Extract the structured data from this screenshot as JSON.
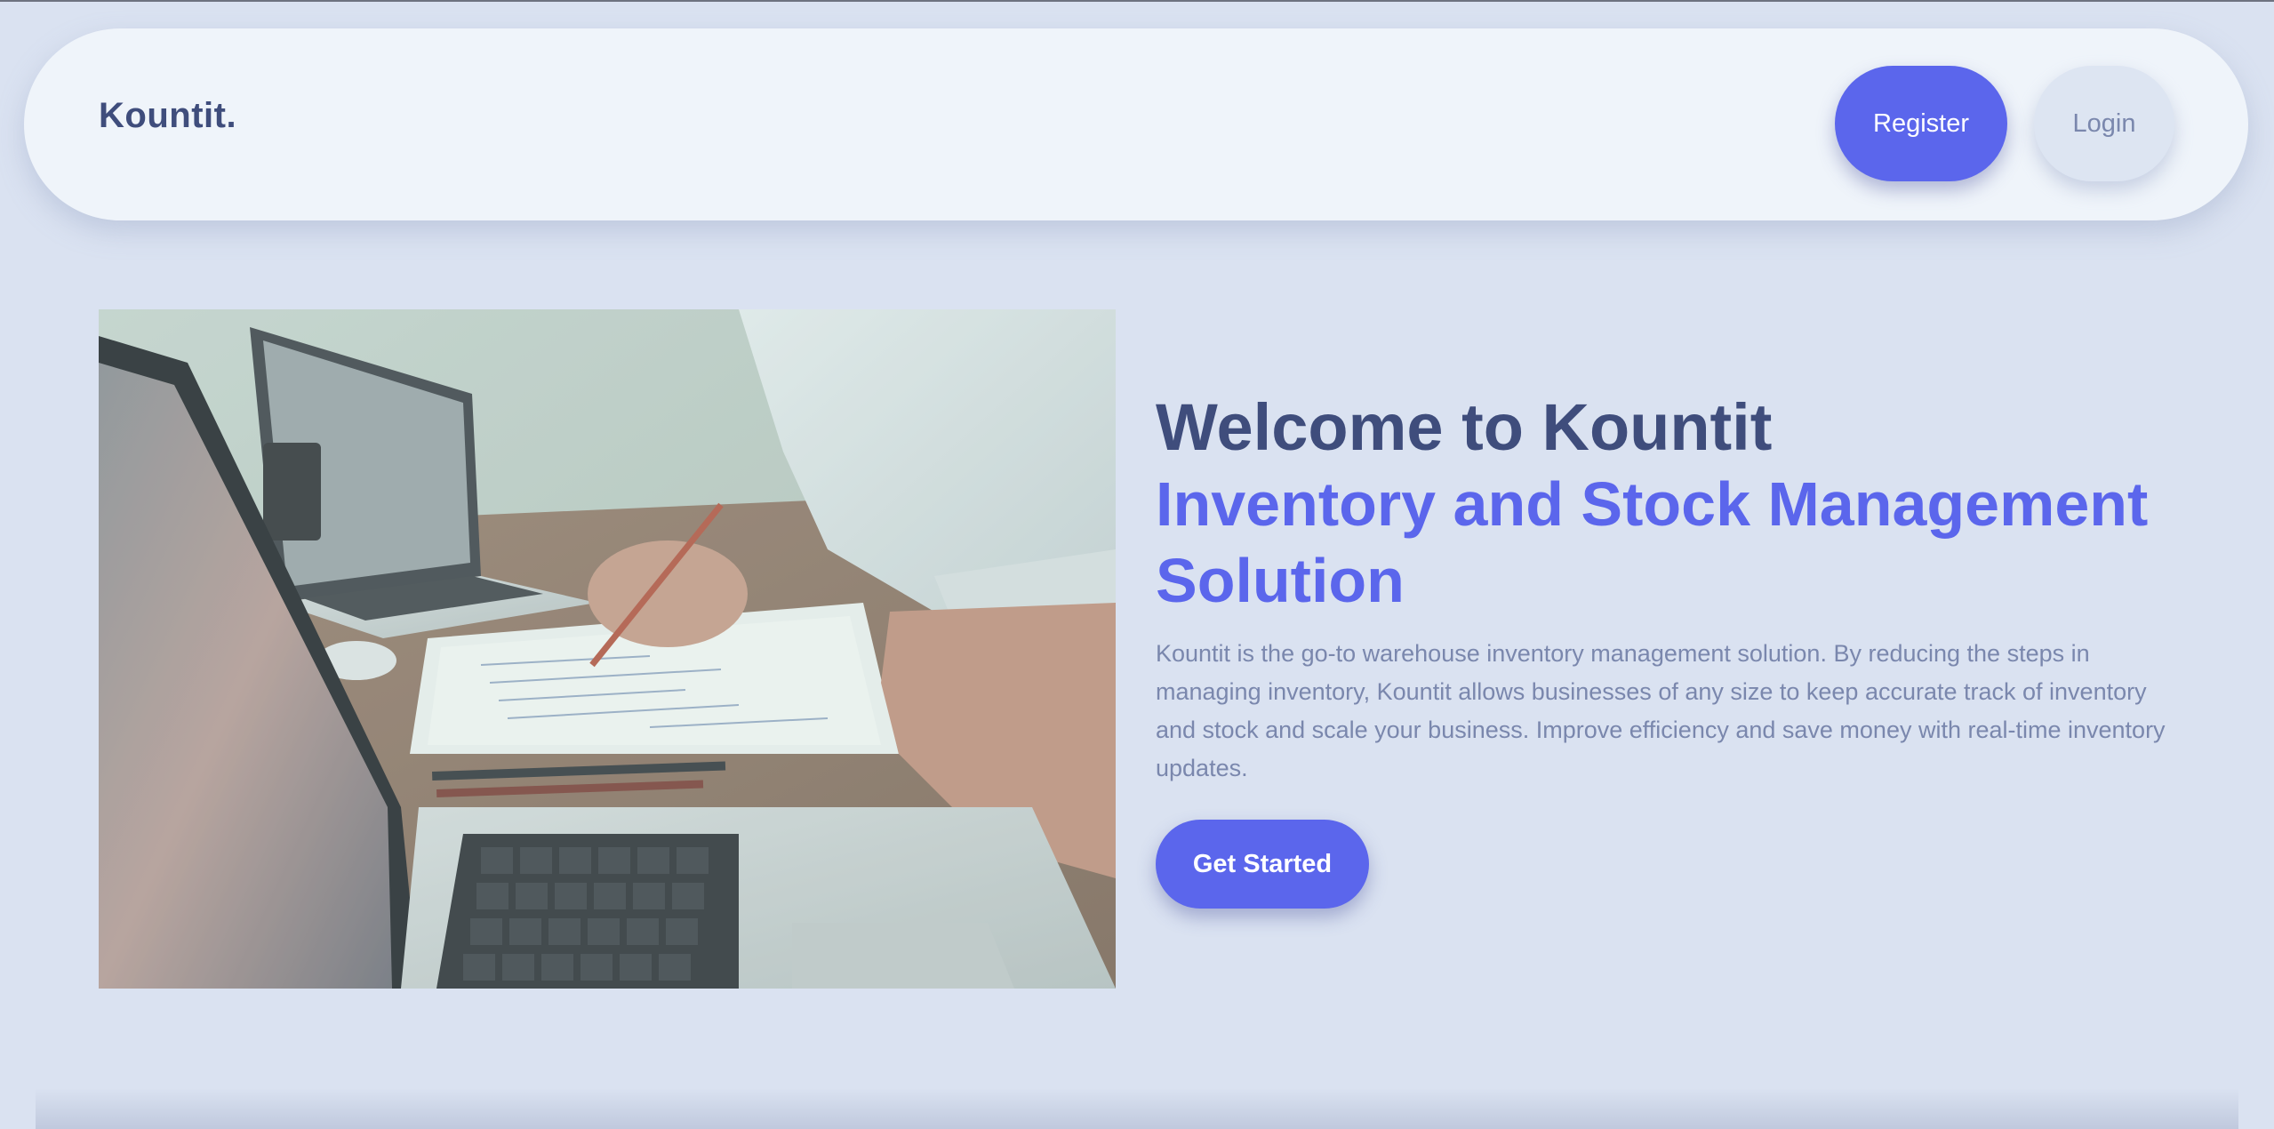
{
  "header": {
    "brand": "Kountit.",
    "register_label": "Register",
    "login_label": "Login"
  },
  "hero": {
    "image_alt": "Business people reviewing documents at a desk with laptops",
    "title_line1": "Welcome to Kountit",
    "title_line2": "Inventory and Stock Management Solution",
    "description": "Kountit is the go-to warehouse inventory management solution. By reducing the steps in managing inventory, Kountit allows businesses of any size to keep accurate track of inventory and stock and scale your business. Improve efficiency and save money with real-time inventory updates.",
    "cta_label": "Get Started"
  },
  "colors": {
    "background": "#dae2f1",
    "navbar": "#eff4fa",
    "accent": "#5b66ec",
    "heading": "#3f4d7c",
    "body_text": "#7a87ad"
  }
}
